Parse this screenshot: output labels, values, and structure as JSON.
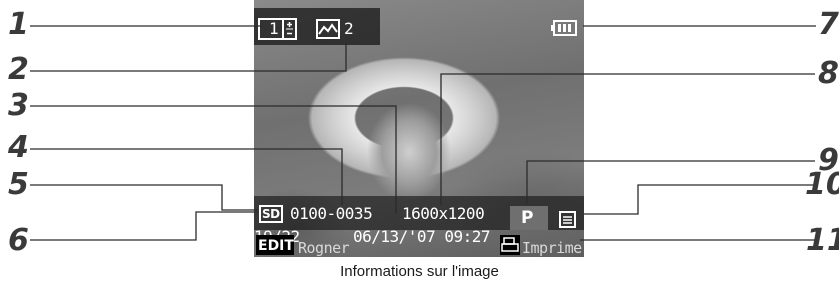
{
  "screen": {
    "exposure_value": "1",
    "landscape_mode_value": "2",
    "file_number": "0100-0035",
    "resolution": "1600x1200",
    "image_counter": "19/22",
    "date_time": "06/13/'07 09:27",
    "print_mode_badge": "P",
    "media_label": "SD",
    "edit_key": "EDIT",
    "edit_label": "Rogner",
    "print_label": "Imprimer",
    "battery_icon": "battery-full-icon"
  },
  "callouts": [
    "1",
    "2",
    "3",
    "4",
    "5",
    "6",
    "7",
    "8",
    "9",
    "10",
    "11"
  ],
  "caption": "Informations sur l'image"
}
